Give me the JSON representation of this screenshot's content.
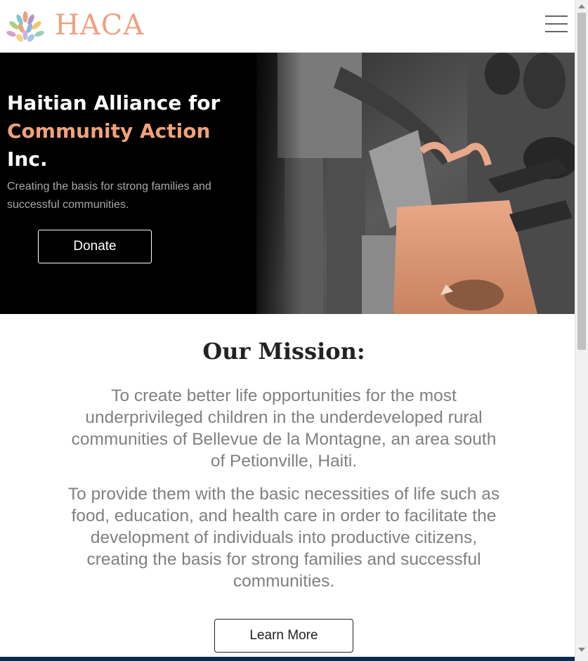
{
  "header": {
    "brand": "HACA",
    "logo_icon": "lotus-logo-icon",
    "menu_icon": "hamburger-menu-icon"
  },
  "hero": {
    "title_line1": "Haitian Alliance for",
    "title_line2": "Community Action",
    "title_line3": "Inc.",
    "subtitle": "Creating the basis for strong families and successful communities.",
    "donate_label": "Donate",
    "photo": "food-bag-distribution-photo"
  },
  "mission": {
    "title": "Our Mission:",
    "paragraph1": "To create better life opportunities for the most underprivileged children in the underdeveloped rural communities of Bellevue de la Montagne, an area south of Petionville, Haiti.",
    "paragraph2": "To provide them with the basic necessities of life such as food, education, and health care in order to facilitate the development of individuals into productive citizens, creating the basis for strong families and successful communities.",
    "learn_more_label": "Learn More"
  },
  "colors": {
    "accent": "#f0a27b",
    "brand": "#eba37f",
    "hero_bg": "#000000",
    "text_muted": "#808080",
    "footer": "#0d2a4a"
  }
}
